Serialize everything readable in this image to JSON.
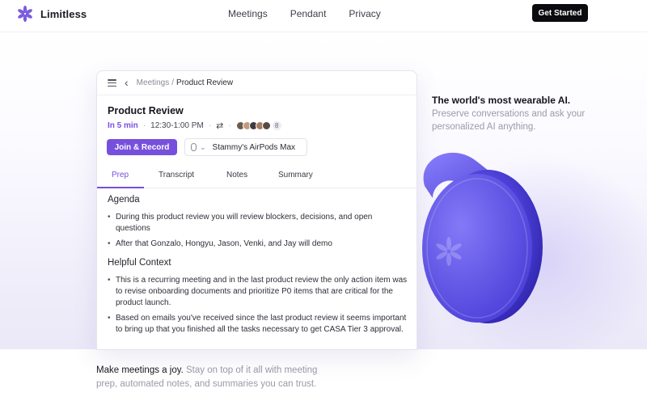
{
  "nav": {
    "brand": "Limitless",
    "links": [
      "Meetings",
      "Pendant",
      "Privacy"
    ],
    "cta": "Get Started"
  },
  "card": {
    "breadcrumb_parent": "Meetings",
    "breadcrumb_current": "Product Review",
    "title": "Product Review",
    "starts_in": "In 5 min",
    "time_range": "12:30-1:00 PM",
    "attendee_extra_count": "8",
    "join_button": "Join & Record",
    "audio_device": "Stammy's AirPods Max",
    "tabs": [
      "Prep",
      "Transcript",
      "Notes",
      "Summary"
    ],
    "active_tab": "Prep",
    "agenda_heading": "Agenda",
    "agenda_items": [
      "During this product review you will review blockers, decisions, and open questions",
      "After that Gonzalo, Hongyu, Jason, Venki, and Jay will demo"
    ],
    "context_heading": "Helpful Context",
    "context_items": [
      "This is a recurring meeting and in the last product review the only action item was to revise onboarding documents and prioritize P0 items that are critical for the product launch.",
      "Based on emails you've received since the last product review it seems important to bring up that you finished all the tasks necessary to get CASA Tier 3 approval."
    ]
  },
  "tagline": {
    "strong": "The world's most wearable AI.",
    "light": "Preserve conversations and ask your personalized AI anything."
  },
  "bottom": {
    "strong": "Make meetings a joy.",
    "light": "Stay on top of it all with meeting prep, automated notes, and summaries you can trust."
  },
  "colors": {
    "accent": "#7650dd",
    "cta_bg": "#0a0a0f",
    "pendant": "#5a4ce6"
  }
}
